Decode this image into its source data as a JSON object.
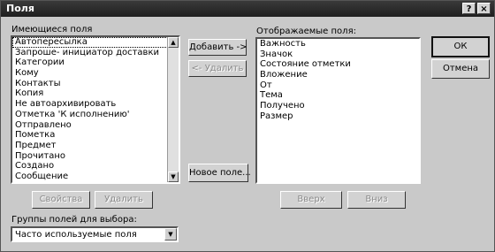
{
  "window": {
    "title": "Поля",
    "help_label": "?",
    "close_label": "×"
  },
  "available": {
    "label": "Имеющиеся поля",
    "items": [
      "Автопересылка",
      "Запроше- инициатор доставки",
      "Категории",
      "Кому",
      "Контакты",
      "Копия",
      "Не автоархивировать",
      "Отметка 'К исполнению'",
      "Отправлено",
      "Пометка",
      "Предмет",
      "Прочитано",
      "Создано",
      "Сообщение"
    ],
    "selected_index": 0
  },
  "shown": {
    "label": "Отображаемые поля:",
    "items": [
      "Важность",
      "Значок",
      "Состояние отметки",
      "Вложение",
      "От",
      "Тема",
      "Получено",
      "Размер"
    ]
  },
  "buttons": {
    "add": "Добавить ->",
    "remove": "<- Удалить",
    "new_field": "Новое поле...",
    "properties": "Свойства",
    "delete": "Удалить",
    "up": "Вверх",
    "down": "Вниз",
    "ok": "ОК",
    "cancel": "Отмена"
  },
  "group": {
    "label": "Группы полей для выбора:",
    "value": "Часто используемые поля"
  }
}
